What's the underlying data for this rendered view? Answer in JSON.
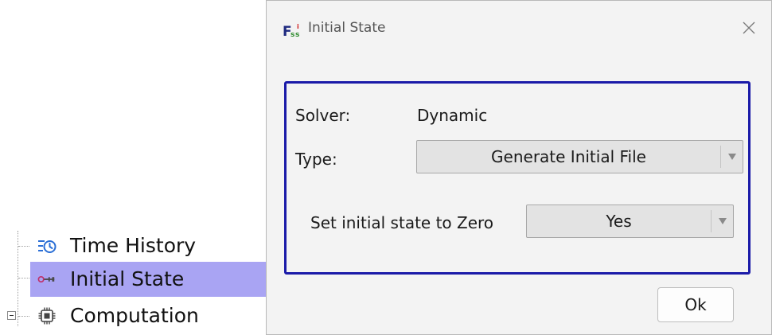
{
  "tree": {
    "items": [
      {
        "label": "Time History",
        "icon": "time-history-icon",
        "selected": false
      },
      {
        "label": "Initial State",
        "icon": "key-icon",
        "selected": true
      },
      {
        "label": "Computation",
        "icon": "chip-icon",
        "selected": false,
        "expandable": true,
        "expanded": true
      }
    ],
    "selection_color": "#a9a4f3"
  },
  "dialog": {
    "title": "Initial State",
    "close_icon": "close-icon",
    "logo_icon": "app-logo-icon",
    "solver": {
      "label": "Solver:",
      "value": "Dynamic"
    },
    "type": {
      "label": "Type:",
      "value": "Generate Initial File"
    },
    "zero_state": {
      "label": "Set initial state to Zero",
      "value": "Yes"
    },
    "ok_label": "Ok",
    "group_border_color": "#1a1aa8"
  }
}
